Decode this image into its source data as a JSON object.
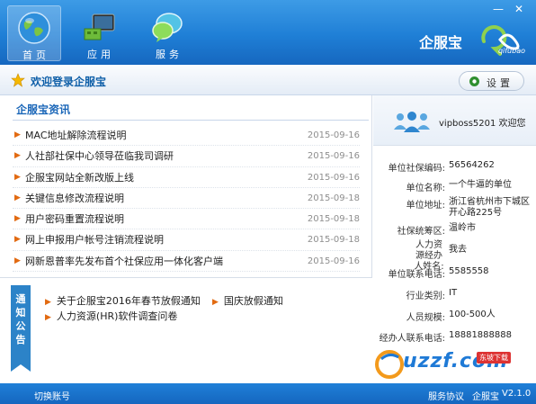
{
  "window": {
    "minimize": "—",
    "close": "✕"
  },
  "nav": [
    {
      "label": "首页",
      "icon": "globe-icon",
      "active": true
    },
    {
      "label": "应用",
      "icon": "monitor-icon",
      "active": false
    },
    {
      "label": "服务",
      "icon": "speech-bubble-icon",
      "active": false
    }
  ],
  "brand": {
    "name": "企服宝",
    "logo_text": "qifubao"
  },
  "welcome": {
    "text": "欢迎登录企服宝",
    "settings_label": "设置"
  },
  "news": {
    "title": "企服宝资讯",
    "items": [
      {
        "title": "MAC地址解除流程说明",
        "date": "2015-09-16"
      },
      {
        "title": "人社部社保中心领导莅临我司调研",
        "date": "2015-09-16"
      },
      {
        "title": "企服宝网站全新改版上线",
        "date": "2015-09-16"
      },
      {
        "title": "关键信息修改流程说明",
        "date": "2015-09-18"
      },
      {
        "title": "用户密码重置流程说明",
        "date": "2015-09-18"
      },
      {
        "title": "网上申报用户帐号注销流程说明",
        "date": "2015-09-18"
      },
      {
        "title": "网新恩普率先发布首个社保应用一体化客户端",
        "date": "2015-09-16"
      }
    ]
  },
  "notice": {
    "tag": "通知公告",
    "links": [
      "关于企服宝2016年春节放假通知",
      "国庆放假通知",
      "人力资源(HR)软件调查问卷"
    ]
  },
  "user": {
    "greeting": "vipboss5201 欢迎您",
    "info": [
      {
        "label": "单位社保编码:",
        "value": "56564262"
      },
      {
        "label": "单位名称:",
        "value": "一个牛逼的单位"
      },
      {
        "label": "单位地址:",
        "value": "浙江省杭州市下城区开心路225号"
      },
      {
        "label": "社保统筹区:",
        "value": "温岭市"
      },
      {
        "label": "人力资源经办人姓名:",
        "value": "我去"
      },
      {
        "label": "单位联系电话:",
        "value": "5585558"
      },
      {
        "label": "行业类别:",
        "value": "IT"
      },
      {
        "label": "人员规模:",
        "value": "100-500人"
      },
      {
        "label": "经办人联系电话:",
        "value": "18881888888"
      }
    ]
  },
  "watermark": {
    "text": "uzzf.com",
    "badge": "东坡下载"
  },
  "footer": {
    "switch_account": "切换账号",
    "service_agreement": "服务协议",
    "brand": "企服宝",
    "version": "V2.1.0"
  }
}
